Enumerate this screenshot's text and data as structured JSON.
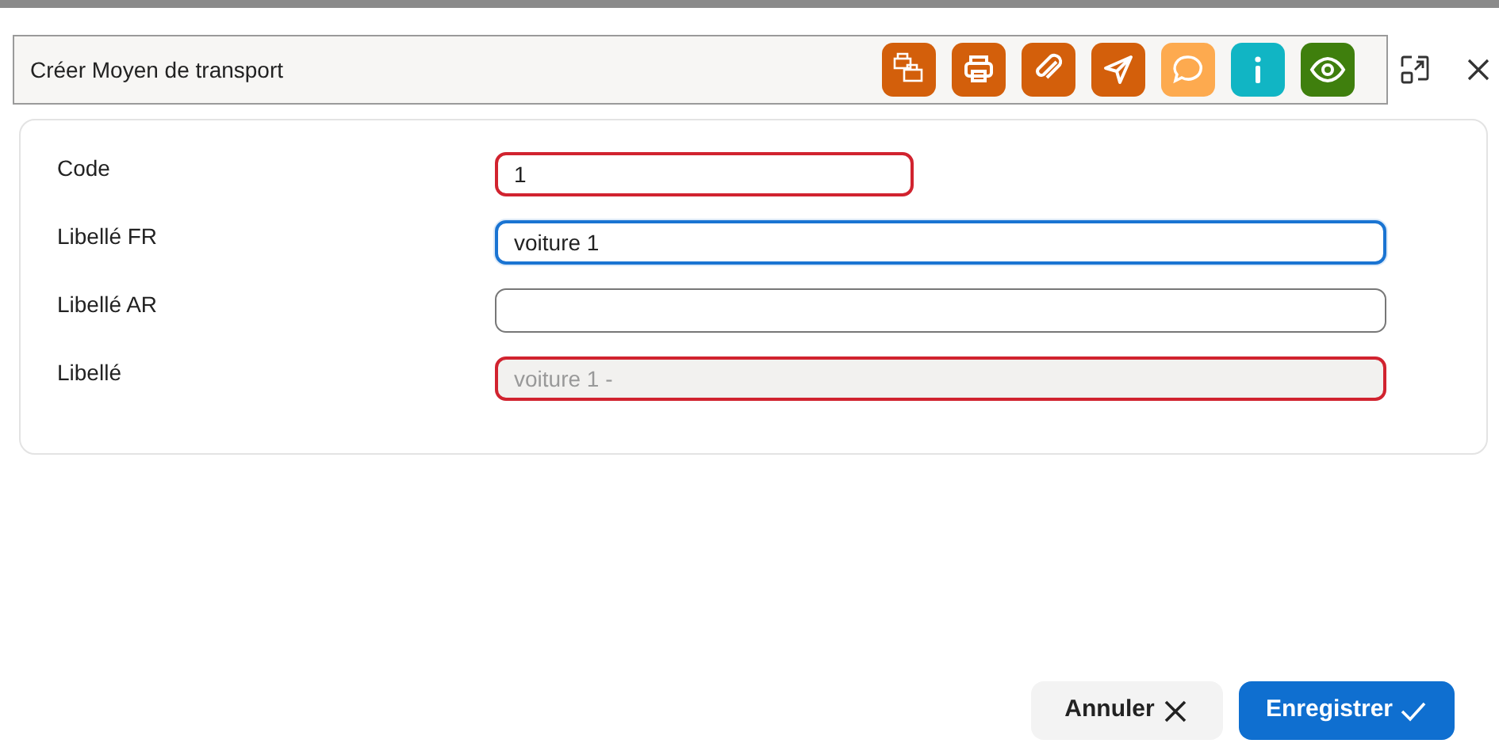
{
  "header": {
    "title": "Créer Moyen de transport"
  },
  "toolbar": [
    {
      "kind": "printers",
      "color": "#d35f0b"
    },
    {
      "kind": "print",
      "color": "#d35f0b"
    },
    {
      "kind": "attach",
      "color": "#d35f0b"
    },
    {
      "kind": "send",
      "color": "#d35f0b"
    },
    {
      "kind": "comment",
      "color": "#fdaa4f"
    },
    {
      "kind": "info",
      "color": "#11b5c4"
    },
    {
      "kind": "view",
      "color": "#3f7f0d"
    }
  ],
  "fields": [
    {
      "label": "Code",
      "value": "1",
      "error": true,
      "focused": false,
      "disabled": false,
      "short": true
    },
    {
      "label": "Libellé FR",
      "value": "voiture 1",
      "error": false,
      "focused": true,
      "disabled": false,
      "short": false
    },
    {
      "label": "Libellé AR",
      "error": false,
      "focused": false,
      "disabled": false,
      "short": false
    },
    {
      "label": "Libellé",
      "value": "voiture 1 -",
      "error": true,
      "focused": false,
      "disabled": true,
      "short": false
    }
  ],
  "buttons": [
    {
      "label": "Annuler",
      "kind": "cancel"
    },
    {
      "label": "Enregistrer",
      "kind": "save"
    }
  ]
}
